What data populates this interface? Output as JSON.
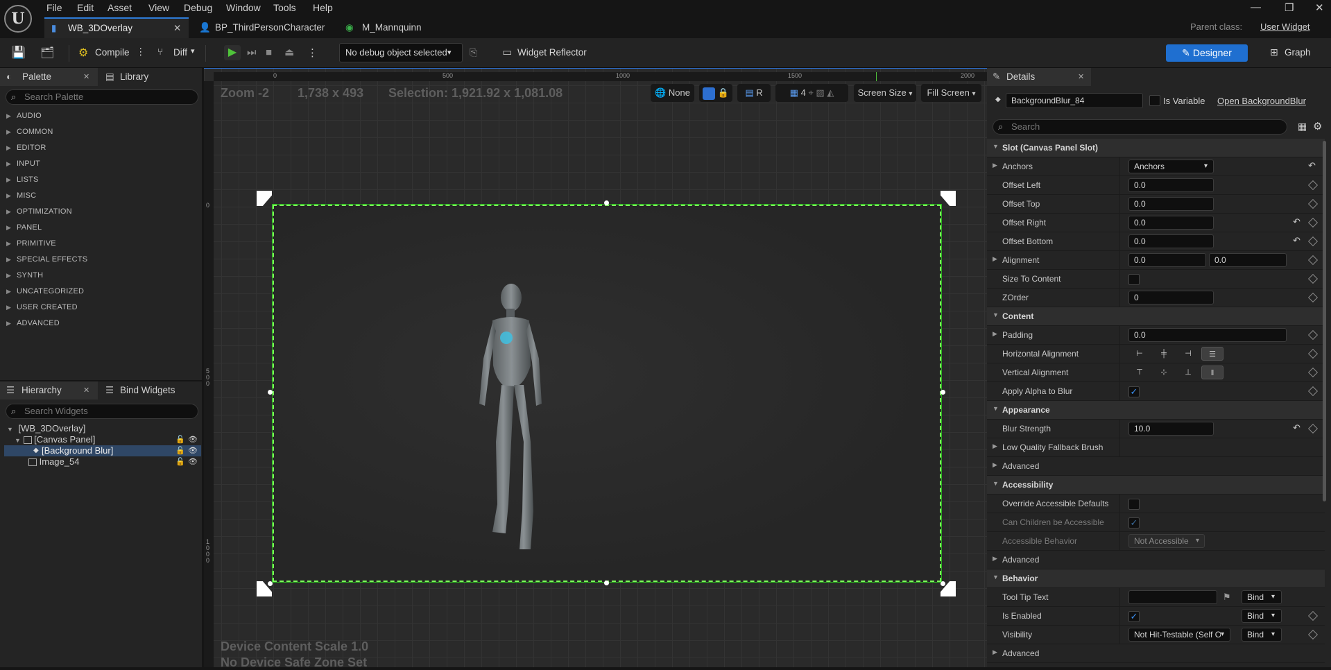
{
  "menu": [
    "File",
    "Edit",
    "Asset",
    "View",
    "Debug",
    "Window",
    "Tools",
    "Help"
  ],
  "tabs": [
    {
      "label": "WB_3DOverlay"
    },
    {
      "label": "BP_ThirdPersonCharacter"
    },
    {
      "label": "M_Mannquinn"
    }
  ],
  "parent_class_label": "Parent class:",
  "parent_class_value": "User Widget",
  "toolbar": {
    "compile": "Compile",
    "diff": "Diff",
    "debug_object": "No debug object selected",
    "widget_reflector": "Widget Reflector",
    "designer": "Designer",
    "graph": "Graph"
  },
  "palette": {
    "tab": "Palette",
    "library_tab": "Library",
    "search_placeholder": "Search Palette",
    "categories": [
      "AUDIO",
      "COMMON",
      "EDITOR",
      "INPUT",
      "LISTS",
      "MISC",
      "OPTIMIZATION",
      "PANEL",
      "PRIMITIVE",
      "SPECIAL EFFECTS",
      "SYNTH",
      "UNCATEGORIZED",
      "USER CREATED",
      "ADVANCED"
    ]
  },
  "hierarchy": {
    "tab": "Hierarchy",
    "bind_tab": "Bind Widgets",
    "search_placeholder": "Search Widgets",
    "items": [
      "[WB_3DOverlay]",
      "[Canvas Panel]",
      "[Background Blur]",
      "Image_54"
    ]
  },
  "viewport": {
    "zoom": "Zoom -2",
    "size": "1,738 x 493",
    "selection": "Selection: 1,921.92 x 1,081.08",
    "none": "None",
    "r": "R",
    "grid": "4",
    "screen_size": "Screen Size",
    "fill_screen": "Fill Screen",
    "scale": "Device Content Scale 1.0",
    "safe_zone": "No Device Safe Zone Set",
    "ruler_h": [
      "0",
      "500",
      "1000",
      "1500",
      "2000"
    ],
    "ruler_v": [
      "0",
      "5\n0\n0",
      "1\n0\n0\n0"
    ]
  },
  "details": {
    "tab": "Details",
    "name": "BackgroundBlur_84",
    "is_variable": "Is Variable",
    "open_link": "Open BackgroundBlur",
    "search_placeholder": "Search",
    "sec_slot": "Slot (Canvas Panel Slot)",
    "anchors": "Anchors",
    "anchors_val": "Anchors",
    "offset_left": "Offset Left",
    "offset_left_val": "0.0",
    "offset_top": "Offset Top",
    "offset_top_val": "0.0",
    "offset_right": "Offset Right",
    "offset_right_val": "0.0",
    "offset_bottom": "Offset Bottom",
    "offset_bottom_val": "0.0",
    "alignment": "Alignment",
    "alignment_x": "0.0",
    "alignment_y": "0.0",
    "size_to_content": "Size To Content",
    "zorder": "ZOrder",
    "zorder_val": "0",
    "sec_content": "Content",
    "padding": "Padding",
    "padding_val": "0.0",
    "h_align": "Horizontal Alignment",
    "v_align": "Vertical Alignment",
    "apply_alpha": "Apply Alpha to Blur",
    "sec_appearance": "Appearance",
    "blur_strength": "Blur Strength",
    "blur_strength_val": "10.0",
    "low_quality": "Low Quality Fallback Brush",
    "advanced": "Advanced",
    "sec_access": "Accessibility",
    "override_access": "Override Accessible Defaults",
    "children_access": "Can Children be Accessible",
    "access_behavior": "Accessible Behavior",
    "access_behavior_val": "Not Accessible",
    "sec_behavior": "Behavior",
    "tooltip": "Tool Tip Text",
    "bind": "Bind",
    "is_enabled": "Is Enabled",
    "visibility": "Visibility",
    "visibility_val": "Not Hit-Testable (Self O"
  }
}
